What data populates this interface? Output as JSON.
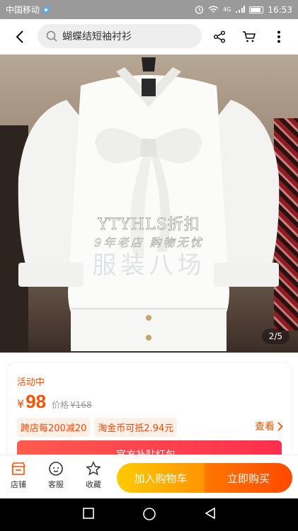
{
  "status": {
    "carrier": "中国移动",
    "network": "4G",
    "time": "16:53"
  },
  "search": {
    "query": "蝴蝶结短袖衬衫"
  },
  "gallery": {
    "watermark_line1": "YTYHLS折扣",
    "watermark_line2": "9年老店 购物无忧",
    "watermark_line3": "服装八场",
    "counter": "2/5"
  },
  "product": {
    "badge": "活动中",
    "currency": "¥",
    "price": "98",
    "orig_label": "价格",
    "orig_price": "¥168",
    "tags": [
      "跨店每200减20",
      "淘金币可抵2.94元"
    ],
    "see_all": "查看",
    "banner_text": "官方补贴红包"
  },
  "actions": {
    "shop": "店铺",
    "service": "客服",
    "favorite": "收藏",
    "add_to_cart": "加入购物车",
    "buy_now": "立即购买"
  },
  "colors": {
    "accent": "#ff5000",
    "cart": "#ffb300",
    "buy": "#ff5a00"
  }
}
